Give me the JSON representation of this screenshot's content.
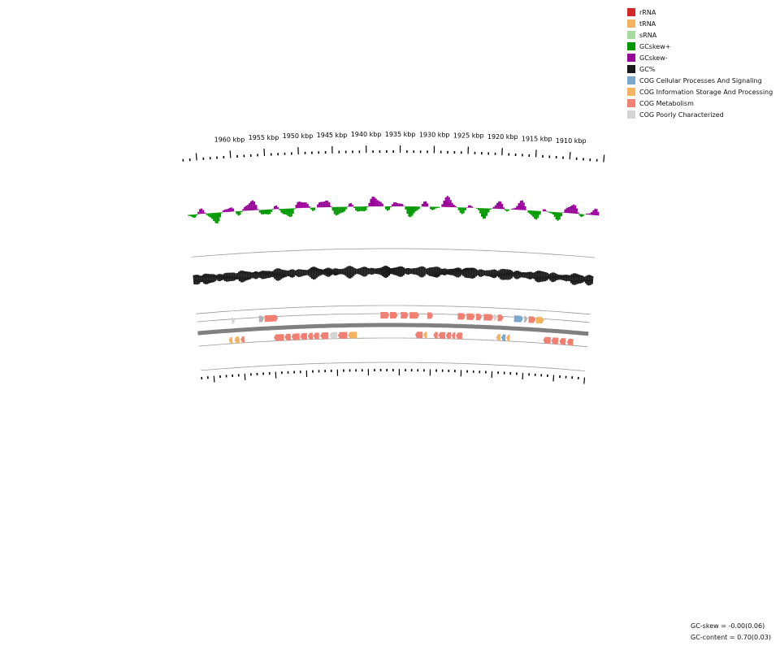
{
  "legend": [
    {
      "label": "rRNA",
      "color": "#d62728"
    },
    {
      "label": "tRNA",
      "color": "#f5b25f"
    },
    {
      "label": "sRNA",
      "color": "#a8dba0"
    },
    {
      "label": "GCskew+",
      "color": "#009900"
    },
    {
      "label": "GCskew-",
      "color": "#990099"
    },
    {
      "label": "GC%",
      "color": "#1a1a1a"
    },
    {
      "label": "COG Cellular Processes And Signaling",
      "color": "#7aa8cc"
    },
    {
      "label": "COG Information Storage And Processing",
      "color": "#f5b25f"
    },
    {
      "label": "COG Metabolism",
      "color": "#f28072"
    },
    {
      "label": "COG Poorly Characterized",
      "color": "#d4d4d4"
    }
  ],
  "scale_labels": [
    "1960 kbp",
    "1955 kbp",
    "1950 kbp",
    "1945 kbp",
    "1940 kbp",
    "1935 kbp",
    "1930 kbp",
    "1925 kbp",
    "1920 kbp",
    "1915 kbp",
    "1910 kbp"
  ],
  "stats": {
    "gc_skew": "GC-skew = -0.00(0.06)",
    "gc_content": "GC-content = 0.70(0.03)"
  },
  "colors": {
    "gc_skew_pos": "#009900",
    "gc_skew_neg": "#990099",
    "gc_content": "#1a1a1a",
    "backbone": "#808080",
    "ring_line": "#9a9a9a"
  },
  "features": {
    "forward": [
      {
        "cog": "poor",
        "start": 1961.5,
        "end": 1961.0
      },
      {
        "cog": "grey",
        "start": 1957.2,
        "end": 1956.4
      },
      {
        "cog": "metabolism",
        "start": 1956.3,
        "end": 1954.2
      },
      {
        "cog": "metabolism",
        "start": 1938.0,
        "end": 1936.6
      },
      {
        "cog": "metabolism",
        "start": 1936.5,
        "end": 1935.3
      },
      {
        "cog": "metabolism",
        "start": 1934.8,
        "end": 1933.6
      },
      {
        "cog": "metabolism",
        "start": 1933.4,
        "end": 1931.9
      },
      {
        "cog": "metabolism",
        "start": 1930.6,
        "end": 1929.7
      },
      {
        "cog": "metabolism",
        "start": 1925.8,
        "end": 1924.6
      },
      {
        "cog": "metabolism",
        "start": 1924.4,
        "end": 1923.1
      },
      {
        "cog": "metabolism",
        "start": 1922.9,
        "end": 1922.0
      },
      {
        "cog": "metabolism",
        "start": 1921.7,
        "end": 1920.2
      },
      {
        "cog": "poor",
        "start": 1920.1,
        "end": 1919.6
      },
      {
        "cog": "metabolism",
        "start": 1919.5,
        "end": 1918.6
      },
      {
        "cog": "cellular",
        "start": 1916.9,
        "end": 1915.5
      },
      {
        "cog": "grey",
        "start": 1915.3,
        "end": 1914.8
      },
      {
        "cog": "metabolism",
        "start": 1914.6,
        "end": 1913.5
      },
      {
        "cog": "trna",
        "start": 1913.4,
        "end": 1912.2
      }
    ],
    "reverse": [
      {
        "cog": "trna",
        "start": 1962.2,
        "end": 1961.6
      },
      {
        "cog": "trna",
        "start": 1961.3,
        "end": 1960.5
      },
      {
        "cog": "metabolism",
        "start": 1960.3,
        "end": 1959.7
      },
      {
        "cog": "metabolism",
        "start": 1955.0,
        "end": 1953.4
      },
      {
        "cog": "metabolism",
        "start": 1953.3,
        "end": 1952.3
      },
      {
        "cog": "metabolism",
        "start": 1952.2,
        "end": 1950.9
      },
      {
        "cog": "metabolism",
        "start": 1950.8,
        "end": 1949.7
      },
      {
        "cog": "metabolism",
        "start": 1949.6,
        "end": 1948.8
      },
      {
        "cog": "metabolism",
        "start": 1948.7,
        "end": 1947.8
      },
      {
        "cog": "metabolism",
        "start": 1947.6,
        "end": 1946.3
      },
      {
        "cog": "poor",
        "start": 1946.1,
        "end": 1944.9
      },
      {
        "cog": "metabolism",
        "start": 1944.8,
        "end": 1943.3
      },
      {
        "cog": "trna",
        "start": 1943.2,
        "end": 1941.8
      },
      {
        "cog": "metabolism",
        "start": 1932.5,
        "end": 1931.3
      },
      {
        "cog": "trna",
        "start": 1931.2,
        "end": 1930.6
      },
      {
        "cog": "metabolism",
        "start": 1929.6,
        "end": 1928.9
      },
      {
        "cog": "metabolism",
        "start": 1928.8,
        "end": 1927.7
      },
      {
        "cog": "metabolism",
        "start": 1927.6,
        "end": 1926.8
      },
      {
        "cog": "metabolism",
        "start": 1926.7,
        "end": 1926.1
      },
      {
        "cog": "metabolism",
        "start": 1926.0,
        "end": 1925.0
      },
      {
        "cog": "trna",
        "start": 1919.6,
        "end": 1918.9
      },
      {
        "cog": "cellular",
        "start": 1918.8,
        "end": 1918.1
      },
      {
        "cog": "trna",
        "start": 1918.0,
        "end": 1917.4
      },
      {
        "cog": "metabolism",
        "start": 1912.1,
        "end": 1910.9
      },
      {
        "cog": "metabolism",
        "start": 1910.8,
        "end": 1909.7
      },
      {
        "cog": "metabolism",
        "start": 1909.5,
        "end": 1908.5
      },
      {
        "cog": "metabolism",
        "start": 1908.3,
        "end": 1907.3
      }
    ]
  }
}
